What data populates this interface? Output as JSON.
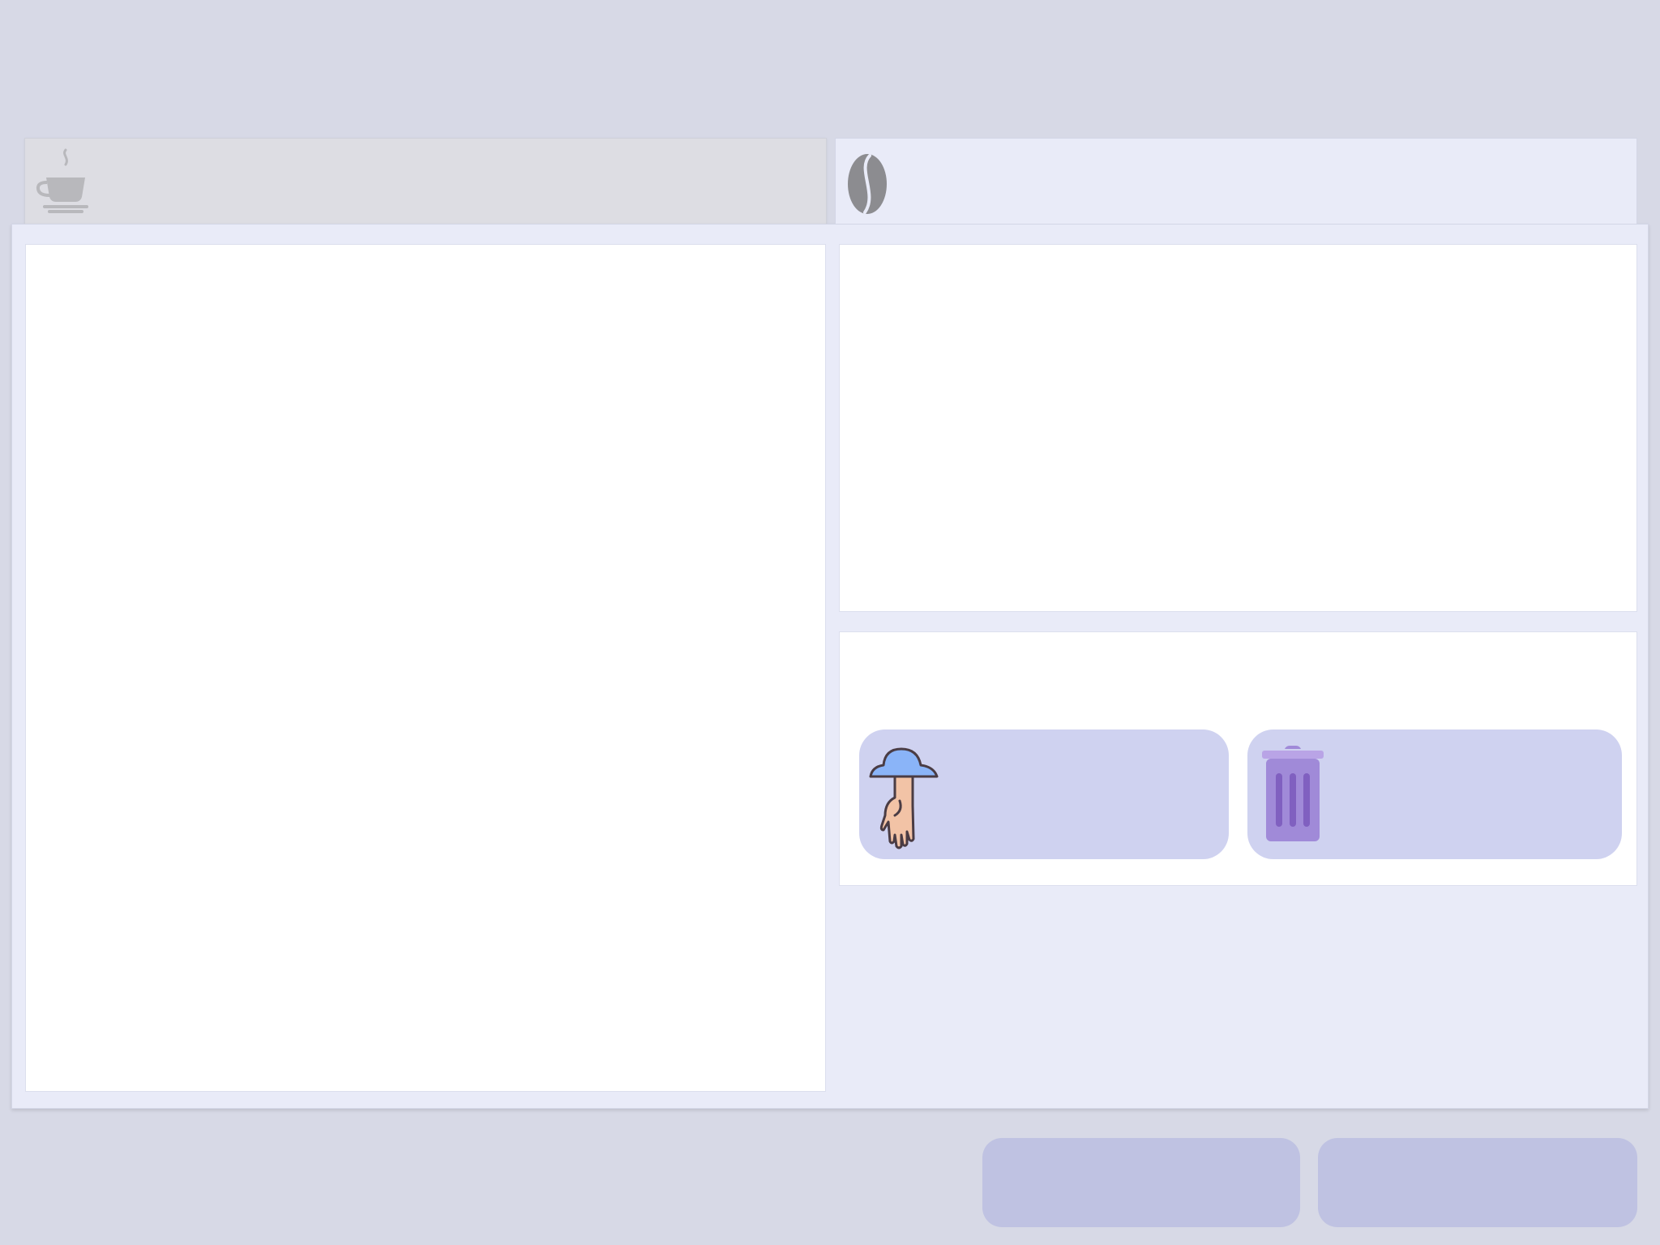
{
  "tabs": [
    {
      "icon": "coffee-cup-icon",
      "label": "",
      "active": false
    },
    {
      "icon": "coffee-bean-icon",
      "label": "",
      "active": true
    }
  ],
  "actions": {
    "pickup": {
      "icon": "hand-cloud-icon",
      "label": ""
    },
    "trash": {
      "icon": "trash-icon",
      "label": ""
    }
  },
  "footer": {
    "left_label": "",
    "right_label": ""
  },
  "colors": {
    "background": "#d7d9e6",
    "window": "#e9ebf8",
    "action_button": "#cfd2f0",
    "footer_button": "#bfc2e2",
    "cloud": "#8ab4f8",
    "trash": "#a08ad8"
  }
}
